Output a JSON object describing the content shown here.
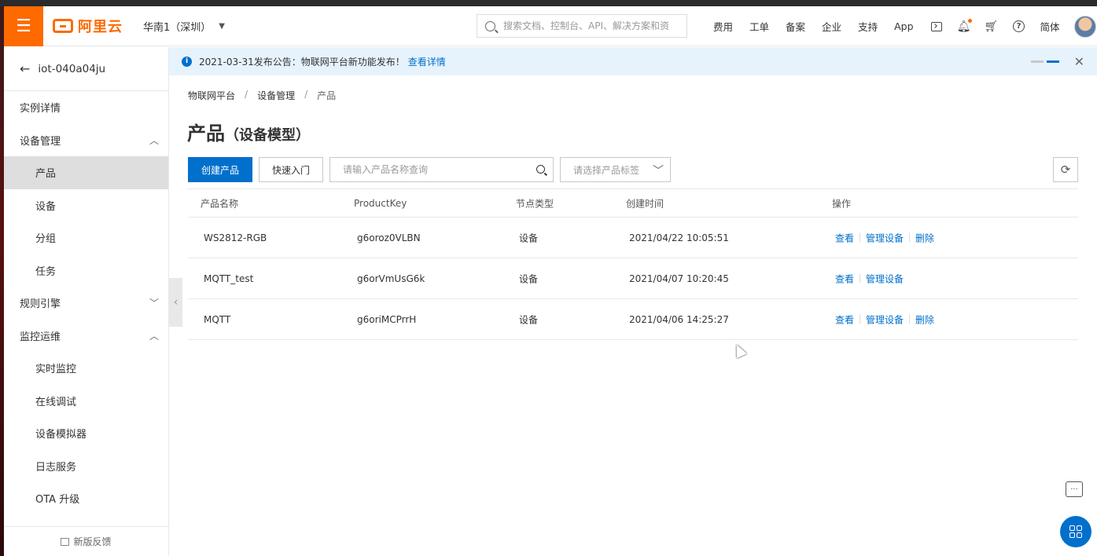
{
  "topbar": {
    "menu_icon": "hamburger-icon",
    "logo_text": "阿里云",
    "region": "华南1（深圳）",
    "search_placeholder": "搜索文档、控制台、API、解决方案和资",
    "nav": [
      "费用",
      "工单",
      "备案",
      "企业",
      "支持",
      "App"
    ],
    "lang": "简体"
  },
  "sidebar": {
    "instance": "iot-040a04ju",
    "items": [
      {
        "label": "实例详情",
        "level": 1
      },
      {
        "label": "设备管理",
        "level": 1,
        "chevron": "up"
      },
      {
        "label": "产品",
        "level": 2,
        "active": true
      },
      {
        "label": "设备",
        "level": 2
      },
      {
        "label": "分组",
        "level": 2
      },
      {
        "label": "任务",
        "level": 2
      },
      {
        "label": "规则引擎",
        "level": 1,
        "chevron": "down"
      },
      {
        "label": "监控运维",
        "level": 1,
        "chevron": "up"
      },
      {
        "label": "实时监控",
        "level": 2
      },
      {
        "label": "在线调试",
        "level": 2
      },
      {
        "label": "设备模拟器",
        "level": 2
      },
      {
        "label": "日志服务",
        "level": 2
      },
      {
        "label": "OTA 升级",
        "level": 2
      }
    ],
    "feedback": "新版反馈"
  },
  "notice": {
    "text": "2021-03-31发布公告：物联网平台新功能发布！",
    "link": "查看详情"
  },
  "breadcrumb": [
    "物联网平台",
    "设备管理",
    "产品"
  ],
  "page": {
    "title": "产品",
    "subtitle": "（设备模型）"
  },
  "toolbar": {
    "create_label": "创建产品",
    "quickstart_label": "快速入门",
    "query_placeholder": "请输入产品名称查询",
    "tag_placeholder": "请选择产品标签"
  },
  "table": {
    "headers": [
      "产品名称",
      "ProductKey",
      "节点类型",
      "创建时间",
      "操作"
    ],
    "rows": [
      {
        "name": "WS2812-RGB",
        "key": "g6oroz0VLBN",
        "node": "设备",
        "time": "2021/04/22 10:05:51",
        "ops": [
          "查看",
          "管理设备",
          "删除"
        ]
      },
      {
        "name": "MQTT_test",
        "key": "g6orVmUsG6k",
        "node": "设备",
        "time": "2021/04/07 10:20:45",
        "ops": [
          "查看",
          "管理设备"
        ]
      },
      {
        "name": "MQTT",
        "key": "g6oriMCPrrH",
        "node": "设备",
        "time": "2021/04/06 14:25:27",
        "ops": [
          "查看",
          "管理设备",
          "删除"
        ]
      }
    ]
  },
  "colors": {
    "brand_orange": "#ff6a00",
    "primary_blue": "#0070cc",
    "notice_bg": "#e7f3fc",
    "active_item_bg": "#dedede"
  }
}
